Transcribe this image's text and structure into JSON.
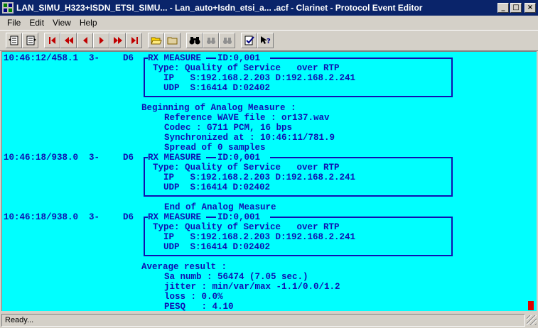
{
  "window": {
    "title": "LAN_SIMU_H323+ISDN_ETSI_SIMU... - Lan_auto+Isdn_etsi_a... .acf - Clarinet - Protocol Event Editor",
    "minimize": "_",
    "maximize": "□",
    "close": "×"
  },
  "menu": [
    "File",
    "Edit",
    "View",
    "Help"
  ],
  "toolbar": {
    "buttons": [
      "toggle-view-1",
      "toggle-view-2",
      "first",
      "prev-fast",
      "prev",
      "next",
      "next-fast",
      "last",
      "open",
      "open-folder",
      "find",
      "find-prev",
      "find-next",
      "properties",
      "help"
    ]
  },
  "content": {
    "events": [
      {
        "timestamp": "10:46:12/458.1",
        "code": "3-",
        "dir": "D6",
        "header": "RX MEASURE",
        "id": "ID:0,001",
        "lines": [
          "Type: Quality of Service   over RTP",
          "  IP   S:192.168.2.203 D:192.168.2.241",
          "  UDP  S:16414 D:02402"
        ]
      },
      {
        "timestamp": "10:46:18/938.0",
        "code": "3-",
        "dir": "D6",
        "header": "RX MEASURE",
        "id": "ID:0,001",
        "lines": [
          "Type: Quality of Service   over RTP",
          "  IP   S:192.168.2.203 D:192.168.2.241",
          "  UDP  S:16414 D:02402"
        ]
      },
      {
        "timestamp": "10:46:18/938.0",
        "code": "3-",
        "dir": "D6",
        "header": "RX MEASURE",
        "id": "ID:0,001",
        "lines": [
          "Type: Quality of Service   over RTP",
          "  IP   S:192.168.2.203 D:192.168.2.241",
          "  UDP  S:16414 D:02402"
        ]
      }
    ],
    "analog_begin": {
      "title": "Beginning of Analog Measure :",
      "lines": [
        "Reference WAVE file : or137.wav",
        "Codec : G711 PCM, 16 bps",
        "Synchronized at : 10:46:11/781.9",
        "Spread of 0 samples"
      ]
    },
    "analog_end": "End of Analog Measure",
    "average": {
      "title": "Average result :",
      "lines": [
        "Sa numb : 56474 (7.05 sec.)",
        "jitter : min/var/max -1.1/0.0/1.2",
        "loss : 0.0%",
        "PESQ   : 4.10"
      ]
    }
  },
  "status": {
    "text": "Ready..."
  }
}
